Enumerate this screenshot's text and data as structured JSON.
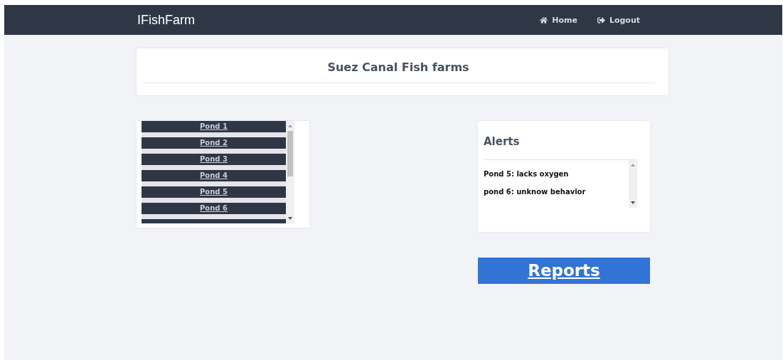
{
  "navbar": {
    "brand": "IFishFarm",
    "links": [
      {
        "kind": "home",
        "label": "Home"
      },
      {
        "kind": "logout",
        "label": "Logout"
      }
    ]
  },
  "header": {
    "title": "Suez Canal Fish farms"
  },
  "ponds": [
    "Pond 1",
    "Pond 2",
    "Pond 3",
    "Pond 4",
    "Pond 5",
    "Pond 6"
  ],
  "alerts": {
    "title": "Alerts",
    "items": [
      "Pond 5: lacks oxygen",
      "pond 6: unknow behavior"
    ]
  },
  "reports_button": "Reports"
}
